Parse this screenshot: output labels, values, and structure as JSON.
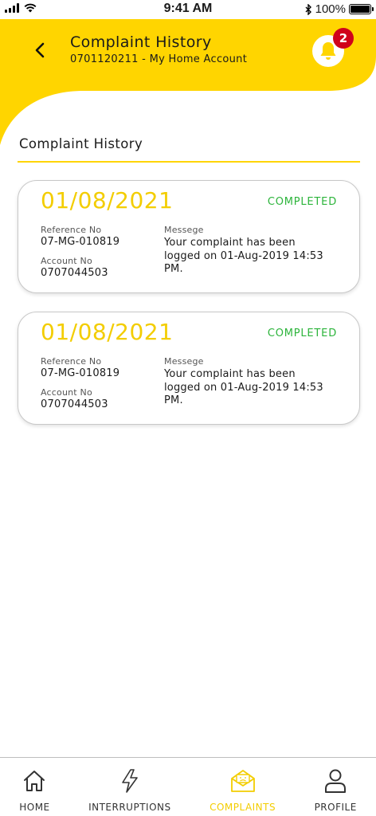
{
  "status_bar": {
    "time": "9:41 AM",
    "battery": "100%"
  },
  "header": {
    "title": "Complaint History",
    "subtitle": "0701120211 - My Home Account",
    "notification_count": "2"
  },
  "section": {
    "title": "Complaint History"
  },
  "complaints": [
    {
      "date": "01/08/2021",
      "status": "COMPLETED",
      "reference_label": "Reference No",
      "reference": "07-MG-010819",
      "account_label": "Account No",
      "account": "0707044503",
      "message_label": "Messege",
      "message": "Your complaint has been logged on 01-Aug-2019 14:53 PM."
    },
    {
      "date": "01/08/2021",
      "status": "COMPLETED",
      "reference_label": "Reference No",
      "reference": "07-MG-010819",
      "account_label": "Account No",
      "account": "0707044503",
      "message_label": "Messege",
      "message": "Your complaint has been logged on 01-Aug-2019 14:53 PM."
    }
  ],
  "nav": {
    "items": [
      {
        "label": "HOME",
        "icon": "home-icon"
      },
      {
        "label": "INTERRUPTIONS",
        "icon": "lightning-icon"
      },
      {
        "label": "COMPLAINTS",
        "icon": "complaint-envelope-icon"
      },
      {
        "label": "PROFILE",
        "icon": "profile-icon"
      }
    ],
    "active_index": 2
  },
  "colors": {
    "brand_yellow": "#ffd500",
    "date_yellow": "#f3cd00",
    "status_green": "#2cb43b",
    "badge_red": "#d0021b"
  }
}
